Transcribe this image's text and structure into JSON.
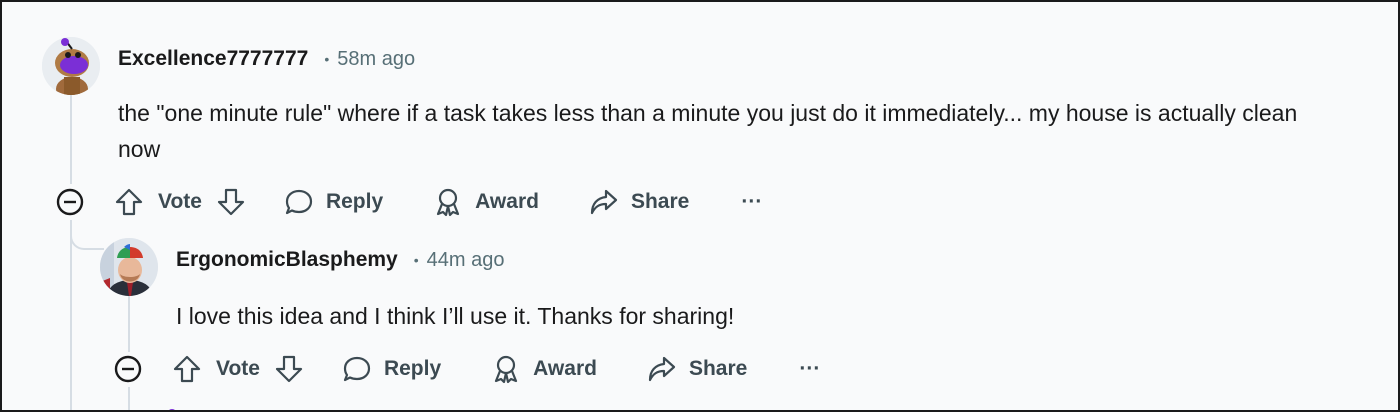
{
  "comments": [
    {
      "username": "Excellence7777777",
      "time": "58m ago",
      "body": "the \"one minute rule\" where if a task takes less than a minute you just do it immediately... my house is actually clean now",
      "actions": {
        "vote": "Vote",
        "reply": "Reply",
        "award": "Award",
        "share": "Share",
        "more": "···"
      }
    },
    {
      "username": "ErgonomicBlasphemy",
      "time": "44m ago",
      "body": "I love this idea and I think I’ll use it. Thanks for sharing!",
      "actions": {
        "vote": "Vote",
        "reply": "Reply",
        "award": "Award",
        "share": "Share",
        "more": "···"
      }
    }
  ],
  "icons": {
    "collapse": "minus-circle-icon",
    "upvote": "arrow-up-icon",
    "downvote": "arrow-down-icon",
    "reply": "speech-bubble-icon",
    "award": "award-ribbon-icon",
    "share": "share-arrow-icon"
  },
  "colors": {
    "text": "#1a1a1b",
    "meta": "#576f76",
    "action": "#3c4a52",
    "thread_line": "#d6dde4",
    "avatar1_accent": "#7b2fd6"
  }
}
